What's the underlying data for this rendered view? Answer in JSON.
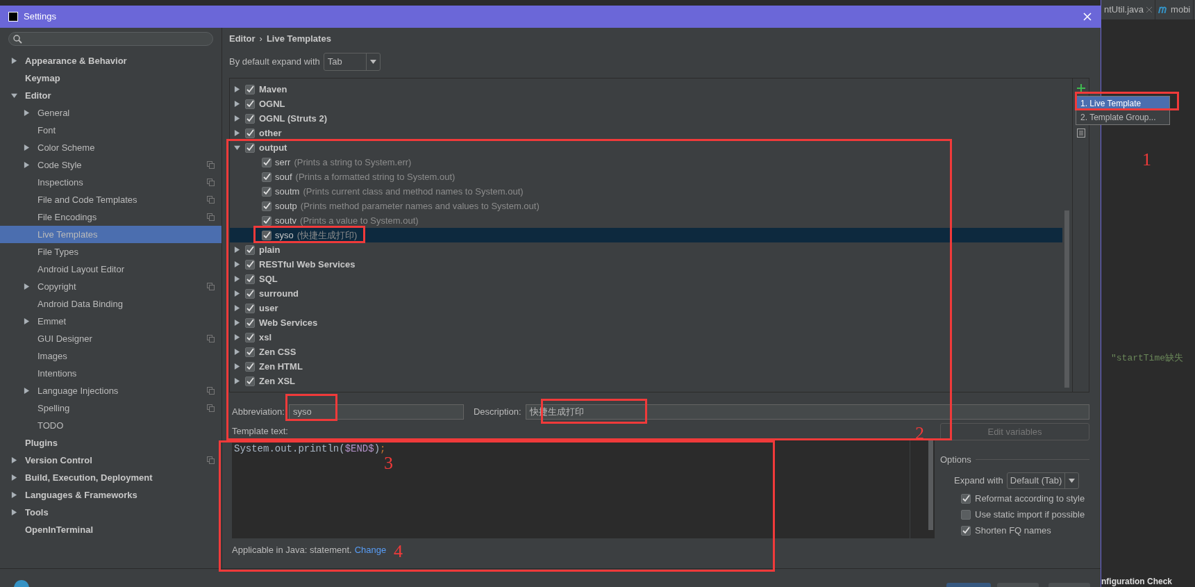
{
  "window": {
    "title": "Settings"
  },
  "sidebar": {
    "items": [
      {
        "label": "Appearance & Behavior",
        "kind": "folder",
        "expanded": false,
        "selected": false,
        "project_icon": false
      },
      {
        "label": "Keymap",
        "kind": "page",
        "selected": false,
        "project_icon": false
      },
      {
        "label": "Editor",
        "kind": "folder",
        "expanded": true,
        "selected": false,
        "project_icon": false,
        "children": [
          {
            "label": "General",
            "kind": "folder",
            "expanded": false,
            "selected": false,
            "project_icon": false
          },
          {
            "label": "Font",
            "kind": "page",
            "selected": false,
            "project_icon": false
          },
          {
            "label": "Color Scheme",
            "kind": "folder",
            "expanded": false,
            "selected": false,
            "project_icon": false
          },
          {
            "label": "Code Style",
            "kind": "folder",
            "expanded": false,
            "selected": false,
            "project_icon": true
          },
          {
            "label": "Inspections",
            "kind": "page",
            "selected": false,
            "project_icon": true
          },
          {
            "label": "File and Code Templates",
            "kind": "page",
            "selected": false,
            "project_icon": true
          },
          {
            "label": "File Encodings",
            "kind": "page",
            "selected": false,
            "project_icon": true
          },
          {
            "label": "Live Templates",
            "kind": "page",
            "selected": true,
            "project_icon": false
          },
          {
            "label": "File Types",
            "kind": "page",
            "selected": false,
            "project_icon": false
          },
          {
            "label": "Android Layout Editor",
            "kind": "page",
            "selected": false,
            "project_icon": false
          },
          {
            "label": "Copyright",
            "kind": "folder",
            "expanded": false,
            "selected": false,
            "project_icon": true
          },
          {
            "label": "Android Data Binding",
            "kind": "page",
            "selected": false,
            "project_icon": false
          },
          {
            "label": "Emmet",
            "kind": "folder",
            "expanded": false,
            "selected": false,
            "project_icon": false
          },
          {
            "label": "GUI Designer",
            "kind": "page",
            "selected": false,
            "project_icon": true
          },
          {
            "label": "Images",
            "kind": "page",
            "selected": false,
            "project_icon": false
          },
          {
            "label": "Intentions",
            "kind": "page",
            "selected": false,
            "project_icon": false
          },
          {
            "label": "Language Injections",
            "kind": "folder",
            "expanded": false,
            "selected": false,
            "project_icon": true
          },
          {
            "label": "Spelling",
            "kind": "page",
            "selected": false,
            "project_icon": true
          },
          {
            "label": "TODO",
            "kind": "page",
            "selected": false,
            "project_icon": false
          }
        ]
      },
      {
        "label": "Plugins",
        "kind": "page",
        "selected": false,
        "project_icon": false
      },
      {
        "label": "Version Control",
        "kind": "folder",
        "expanded": false,
        "selected": false,
        "project_icon": true
      },
      {
        "label": "Build, Execution, Deployment",
        "kind": "folder",
        "expanded": false,
        "selected": false,
        "project_icon": false
      },
      {
        "label": "Languages & Frameworks",
        "kind": "folder",
        "expanded": false,
        "selected": false,
        "project_icon": false
      },
      {
        "label": "Tools",
        "kind": "folder",
        "expanded": false,
        "selected": false,
        "project_icon": false
      },
      {
        "label": "OpenInTerminal",
        "kind": "page",
        "selected": false,
        "project_icon": false
      }
    ]
  },
  "breadcrumb": {
    "items": [
      "Editor",
      "Live Templates"
    ],
    "separator": "›"
  },
  "expand_default": {
    "label": "By default expand with",
    "value": "Tab"
  },
  "template_groups": [
    {
      "name": "Maven",
      "checked": true,
      "expanded": false,
      "selected": false
    },
    {
      "name": "OGNL",
      "checked": true,
      "expanded": false,
      "selected": false
    },
    {
      "name": "OGNL (Struts 2)",
      "checked": true,
      "expanded": false,
      "selected": false
    },
    {
      "name": "other",
      "checked": true,
      "expanded": false,
      "selected": false
    },
    {
      "name": "output",
      "checked": true,
      "expanded": true,
      "selected": false,
      "children": [
        {
          "abbreviation": "serr",
          "description": "(Prints a string to System.err)",
          "checked": true,
          "selected": false
        },
        {
          "abbreviation": "souf",
          "description": "(Prints a formatted string to System.out)",
          "checked": true,
          "selected": false
        },
        {
          "abbreviation": "soutm",
          "description": "(Prints current class and method names to System.out)",
          "checked": true,
          "selected": false
        },
        {
          "abbreviation": "soutp",
          "description": "(Prints method parameter names and values to System.out)",
          "checked": true,
          "selected": false
        },
        {
          "abbreviation": "soutv",
          "description": "(Prints a value to System.out)",
          "checked": true,
          "selected": false
        },
        {
          "abbreviation": "syso",
          "description": "(快捷生成打印)",
          "checked": true,
          "selected": true
        }
      ]
    },
    {
      "name": "plain",
      "checked": true,
      "expanded": false,
      "selected": false
    },
    {
      "name": "RESTful Web Services",
      "checked": true,
      "expanded": false,
      "selected": false
    },
    {
      "name": "SQL",
      "checked": true,
      "expanded": false,
      "selected": false
    },
    {
      "name": "surround",
      "checked": true,
      "expanded": false,
      "selected": false
    },
    {
      "name": "user",
      "checked": true,
      "expanded": false,
      "selected": false
    },
    {
      "name": "Web Services",
      "checked": true,
      "expanded": false,
      "selected": false
    },
    {
      "name": "xsl",
      "checked": true,
      "expanded": false,
      "selected": false
    },
    {
      "name": "Zen CSS",
      "checked": true,
      "expanded": false,
      "selected": false
    },
    {
      "name": "Zen HTML",
      "checked": true,
      "expanded": false,
      "selected": false
    },
    {
      "name": "Zen XSL",
      "checked": true,
      "expanded": false,
      "selected": false
    }
  ],
  "add_menu": {
    "items": [
      {
        "label": "1. Live Template",
        "selected": true
      },
      {
        "label": "2. Template Group...",
        "selected": false
      }
    ]
  },
  "abbreviation": {
    "label": "Abbreviation:",
    "value": "syso"
  },
  "description": {
    "label": "Description:",
    "value": "快捷生成打印"
  },
  "template_text": {
    "label": "Template text:",
    "code": [
      {
        "text": "System.out.println(",
        "kind": "plain"
      },
      {
        "text": "$END$",
        "kind": "variable"
      },
      {
        "text": ")",
        "kind": "plain"
      },
      {
        "text": ";",
        "kind": "punct"
      }
    ]
  },
  "edit_variables": {
    "label": "Edit variables",
    "disabled": true
  },
  "options": {
    "title": "Options",
    "expand_with": {
      "label": "Expand with",
      "value": "Default (Tab)"
    },
    "checkboxes": [
      {
        "label": "Reformat according to style",
        "checked": true
      },
      {
        "label": "Use static import if possible",
        "checked": false
      },
      {
        "label": "Shorten FQ names",
        "checked": true
      }
    ]
  },
  "applicable": {
    "text": "Applicable in Java: statement.",
    "link": "Change"
  },
  "ide": {
    "tabs": [
      {
        "label": "ntUtil.java",
        "kind": "java",
        "closable": true
      },
      {
        "label": "mobi",
        "kind": "maven",
        "closable": false
      }
    ],
    "code_text": "″startTime缺失",
    "status_text": "nfiguration Check"
  },
  "annotations": [
    "1",
    "2",
    "3",
    "4"
  ]
}
